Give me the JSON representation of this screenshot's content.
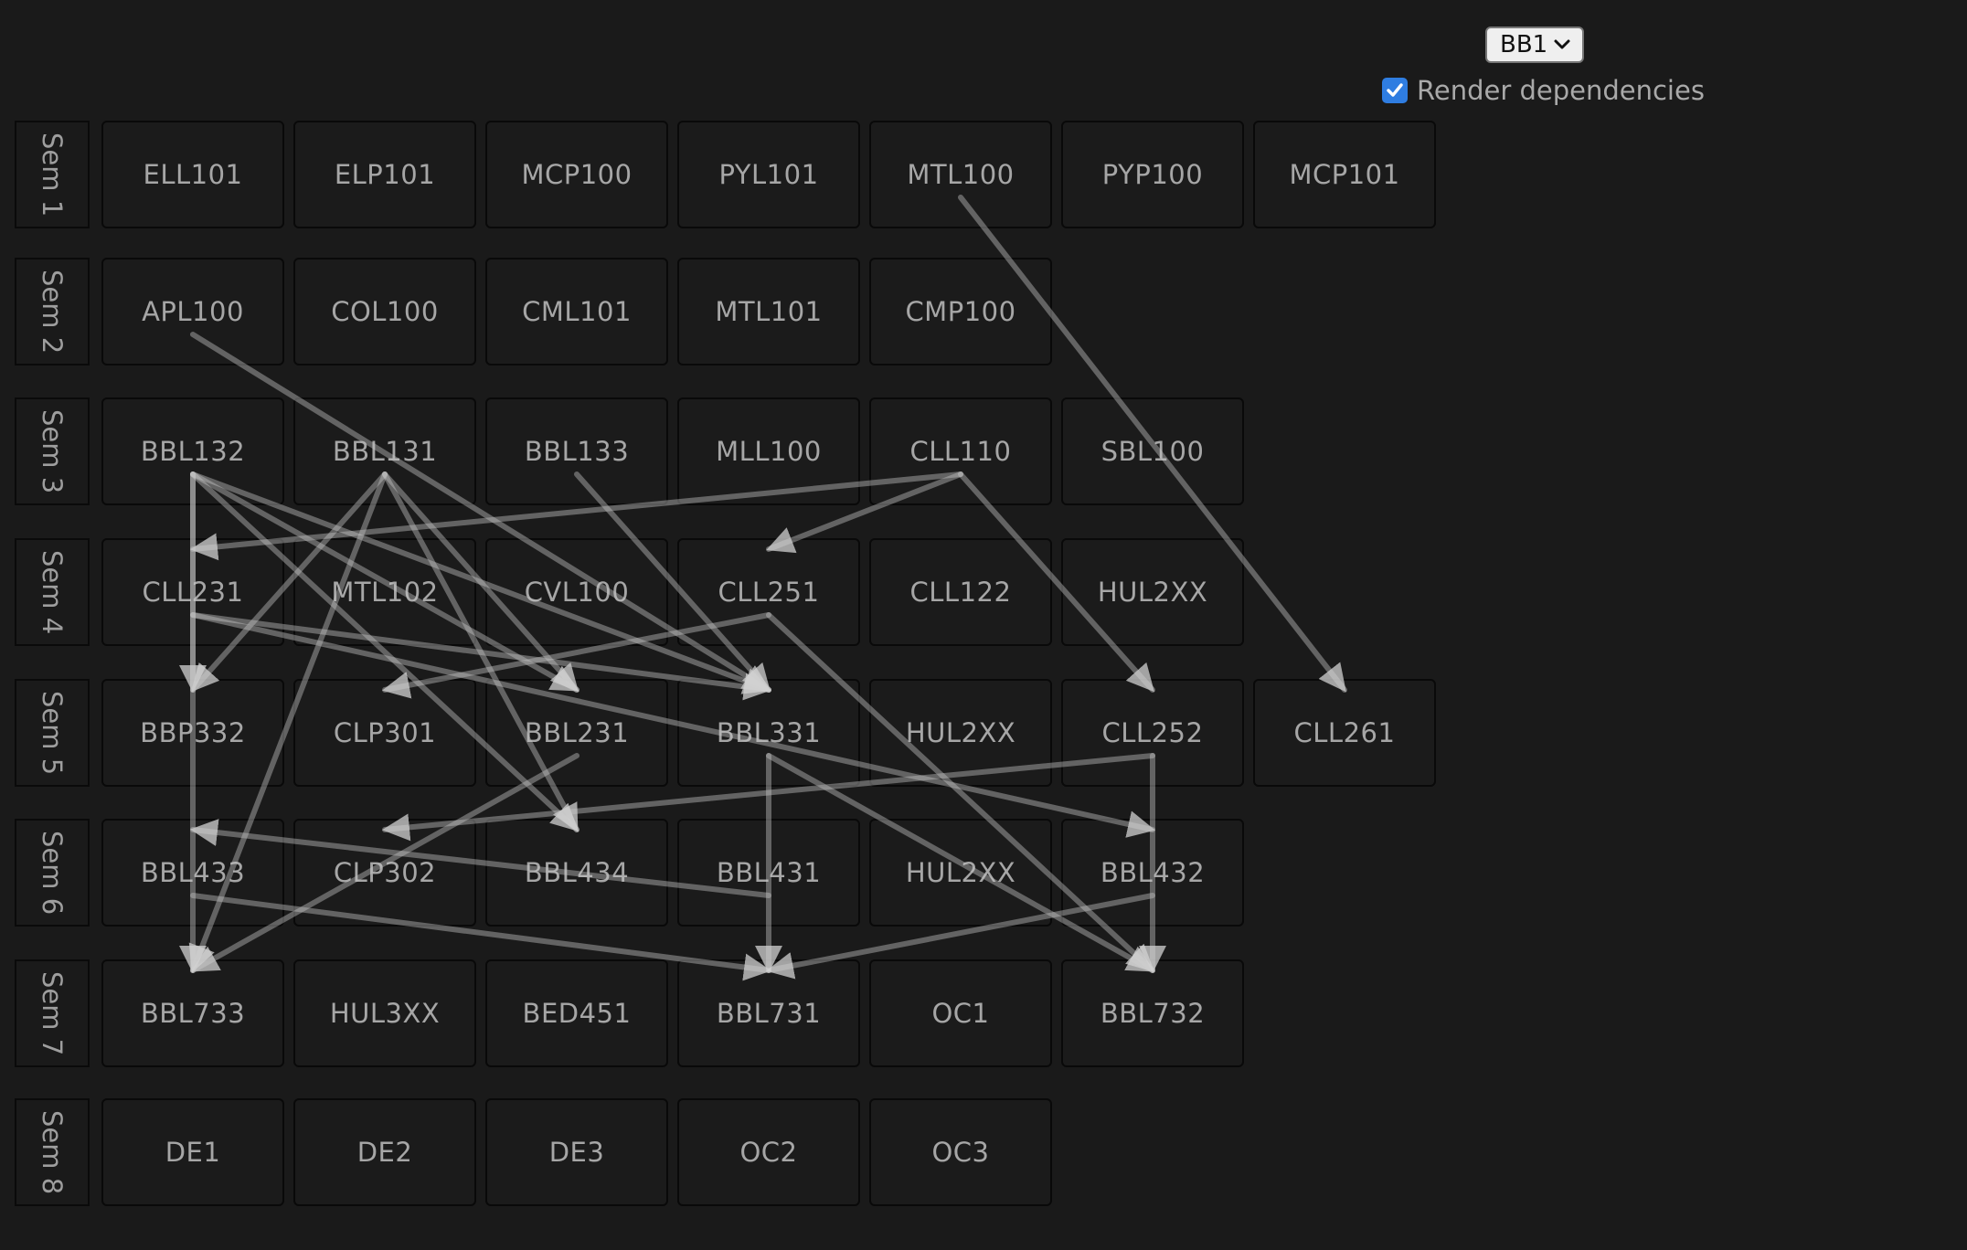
{
  "controls": {
    "degree_select": {
      "value": "BB1"
    },
    "render_dependencies": {
      "label": "Render dependencies",
      "checked": true
    }
  },
  "semesters": [
    {
      "label": "Sem 1",
      "courses": [
        "ELL101",
        "ELP101",
        "MCP100",
        "PYL101",
        "MTL100",
        "PYP100",
        "MCP101"
      ]
    },
    {
      "label": "Sem 2",
      "courses": [
        "APL100",
        "COL100",
        "CML101",
        "MTL101",
        "CMP100"
      ]
    },
    {
      "label": "Sem 3",
      "courses": [
        "BBL132",
        "BBL131",
        "BBL133",
        "MLL100",
        "CLL110",
        "SBL100"
      ]
    },
    {
      "label": "Sem 4",
      "courses": [
        "CLL231",
        "MTL102",
        "CVL100",
        "CLL251",
        "CLL122",
        "HUL2XX"
      ]
    },
    {
      "label": "Sem 5",
      "courses": [
        "BBP332",
        "CLP301",
        "BBL231",
        "BBL331",
        "HUL2XX",
        "CLL252",
        "CLL261"
      ]
    },
    {
      "label": "Sem 6",
      "courses": [
        "BBL433",
        "CLP302",
        "BBL434",
        "BBL431",
        "HUL2XX",
        "BBL432"
      ]
    },
    {
      "label": "Sem 7",
      "courses": [
        "BBL733",
        "HUL3XX",
        "BED451",
        "BBL731",
        "OC1",
        "BBL732"
      ]
    },
    {
      "label": "Sem 8",
      "courses": [
        "DE1",
        "DE2",
        "DE3",
        "OC2",
        "OC3"
      ]
    }
  ],
  "dependencies": [
    {
      "from": "MTL100",
      "to": "CLL261"
    },
    {
      "from": "APL100",
      "to": "BBL331"
    },
    {
      "from": "BBL132",
      "to": "BBP332"
    },
    {
      "from": "BBL132",
      "to": "BBL231"
    },
    {
      "from": "BBL132",
      "to": "BBL331"
    },
    {
      "from": "BBL132",
      "to": "BBL434"
    },
    {
      "from": "BBL131",
      "to": "BBP332"
    },
    {
      "from": "BBL131",
      "to": "BBL231"
    },
    {
      "from": "BBL131",
      "to": "BBL434"
    },
    {
      "from": "BBL131",
      "to": "BBL733"
    },
    {
      "from": "BBL133",
      "to": "BBL331"
    },
    {
      "from": "CLL110",
      "to": "CLL231"
    },
    {
      "from": "CLL110",
      "to": "CLL251"
    },
    {
      "from": "CLL110",
      "to": "CLL252"
    },
    {
      "from": "CLL231",
      "to": "BBL331"
    },
    {
      "from": "CLL231",
      "to": "BBL432"
    },
    {
      "from": "CLL251",
      "to": "CLP301"
    },
    {
      "from": "CLL251",
      "to": "BBL732"
    },
    {
      "from": "BBL231",
      "to": "BBL733"
    },
    {
      "from": "BBL331",
      "to": "BBL731"
    },
    {
      "from": "BBL331",
      "to": "BBL732"
    },
    {
      "from": "CLL252",
      "to": "CLP302"
    },
    {
      "from": "CLL252",
      "to": "BBL732"
    },
    {
      "from": "BBL431",
      "to": "BBL433"
    },
    {
      "from": "BBL433",
      "to": "BBL731"
    },
    {
      "from": "BBL432",
      "to": "BBL731"
    },
    {
      "from": "BBL132",
      "to": "BBL733"
    }
  ]
}
